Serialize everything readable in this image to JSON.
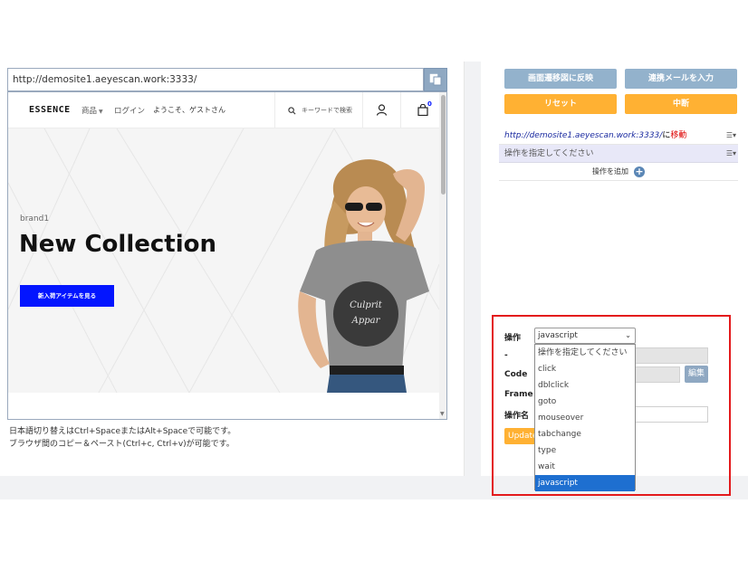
{
  "address_bar": {
    "url": "http://demosite1.aeyescan.work:3333/"
  },
  "site": {
    "logo": "ESSENCE",
    "nav_products": "商品",
    "nav_login": "ログイン",
    "welcome": "ようこそ、ゲストさん",
    "search_placeholder": "キーワードで検索",
    "cart_count": "0",
    "hero_brand": "brand1",
    "hero_title": "New Collection",
    "hero_button": "新入荷アイテムを見る",
    "shirt_text": "Culprit Apparel"
  },
  "help_lines": [
    "日本語切り替えはCtrl+SpaceまたはAlt+Spaceで可能です。",
    "ブラウザ間のコピー＆ペースト(Ctrl+c, Ctrl+v)が可能です。"
  ],
  "buttons": {
    "reflect": "画面遷移図に反映",
    "mail": "連携メールを入力",
    "reset": "リセット",
    "stop": "中断"
  },
  "operations": {
    "row1_url": "http://demosite1.aeyescan.work:3333/",
    "row1_suffix": "に",
    "row1_action": "移動",
    "row2_text": "操作を指定してください",
    "add_label": "操作を追加"
  },
  "form": {
    "label_operation": "操作",
    "label_dash": "-",
    "label_code": "Code",
    "label_frame": "Frame",
    "label_opname": "操作名",
    "edit_label": "編集",
    "update_label": "Update",
    "selected_value": "javascript",
    "options": [
      "操作を指定してください",
      "click",
      "dblclick",
      "goto",
      "mouseover",
      "tabchange",
      "type",
      "wait",
      "javascript"
    ]
  },
  "colors": {
    "accent_blue": "#0315ff",
    "button_blue": "#93b2cc",
    "button_orange": "#ffb133",
    "highlight_red": "#e31a1c",
    "selection_blue": "#1e6fd0"
  }
}
